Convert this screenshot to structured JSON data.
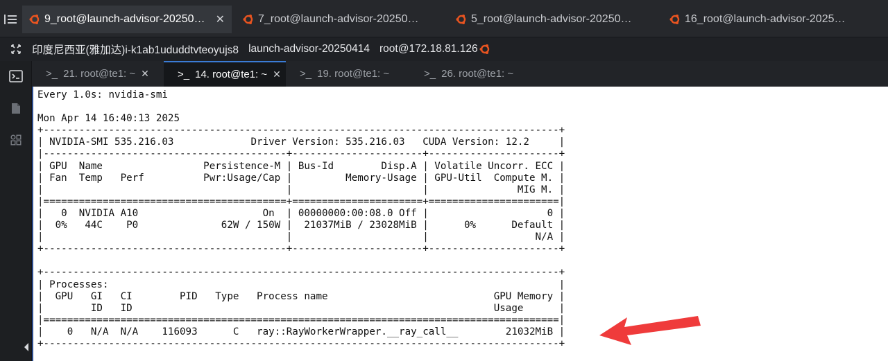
{
  "session_tabs": [
    {
      "label": "9_root@launch-advisor-20250…",
      "active": true
    },
    {
      "label": "7_root@launch-advisor-20250…",
      "active": false
    },
    {
      "label": "5_root@launch-advisor-20250…",
      "active": false
    },
    {
      "label": "16_root@launch-advisor-2025…",
      "active": false
    }
  ],
  "info_bar": {
    "instance": "印度尼西亚(雅加达)i-k1ab1ududdtvteoyujs8",
    "host": "launch-advisor-20250414",
    "user": "root@172.18.81.126"
  },
  "terminal_tabs": [
    {
      "label": "21. root@te1: ~",
      "active": false
    },
    {
      "label": "14. root@te1: ~",
      "active": true
    },
    {
      "label": "19. root@te1: ~",
      "active": false
    },
    {
      "label": "26. root@te1: ~",
      "active": false
    }
  ],
  "icons": {
    "menu": "list-menu-icon",
    "session": "ubuntu-icon",
    "expand": "expand-icon",
    "terminal": "terminal-icon",
    "file": "file-icon",
    "apps": "apps-icon",
    "prompt": "prompt-icon",
    "arrow": "red-arrow-icon"
  },
  "colors": {
    "accent": "#3a7bd5",
    "ubuntu": "#e95420",
    "arrow": "#ef3b3b"
  },
  "terminal": {
    "lines": [
      "Every 1.0s: nvidia-smi",
      "",
      "Mon Apr 14 16:40:13 2025",
      "+---------------------------------------------------------------------------------------+",
      "| NVIDIA-SMI 535.216.03             Driver Version: 535.216.03   CUDA Version: 12.2     |",
      "|-----------------------------------------+----------------------+----------------------+",
      "| GPU  Name                 Persistence-M | Bus-Id        Disp.A | Volatile Uncorr. ECC |",
      "| Fan  Temp   Perf          Pwr:Usage/Cap |         Memory-Usage | GPU-Util  Compute M. |",
      "|                                         |                      |               MIG M. |",
      "|=========================================+======================+======================|",
      "|   0  NVIDIA A10                     On  | 00000000:00:08.0 Off |                    0 |",
      "|  0%   44C    P0              62W / 150W |  21037MiB / 23028MiB |      0%      Default |",
      "|                                         |                      |                  N/A |",
      "+-----------------------------------------+----------------------+----------------------+",
      "",
      "+---------------------------------------------------------------------------------------+",
      "| Processes:                                                                            |",
      "|  GPU   GI   CI        PID   Type   Process name                            GPU Memory |",
      "|        ID   ID                                                             Usage      |",
      "|=======================================================================================|",
      "|    0   N/A  N/A    116093      C   ray::RayWorkerWrapper.__ray_call__        21032MiB |",
      "+---------------------------------------------------------------------------------------+"
    ]
  }
}
